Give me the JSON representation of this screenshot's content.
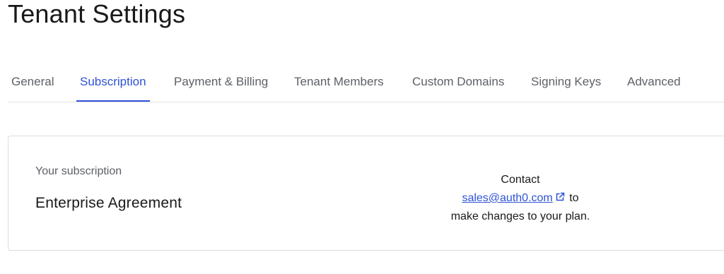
{
  "header": {
    "title": "Tenant Settings"
  },
  "tabs": [
    {
      "label": "General",
      "active": false
    },
    {
      "label": "Subscription",
      "active": true
    },
    {
      "label": "Payment & Billing",
      "active": false
    },
    {
      "label": "Tenant Members",
      "active": false
    },
    {
      "label": "Custom Domains",
      "active": false
    },
    {
      "label": "Signing Keys",
      "active": false
    },
    {
      "label": "Advanced",
      "active": false
    }
  ],
  "subscription": {
    "label": "Your subscription",
    "plan": "Enterprise Agreement"
  },
  "contact": {
    "prefix": "Contact",
    "email": "sales@auth0.com",
    "link_icon": "external-link-icon",
    "after_link": "to",
    "suffix": "make changes to your plan."
  },
  "colors": {
    "accent": "#3452d8",
    "link": "#2f52d6",
    "muted_text": "#5d6068",
    "border": "#dcdde1"
  }
}
